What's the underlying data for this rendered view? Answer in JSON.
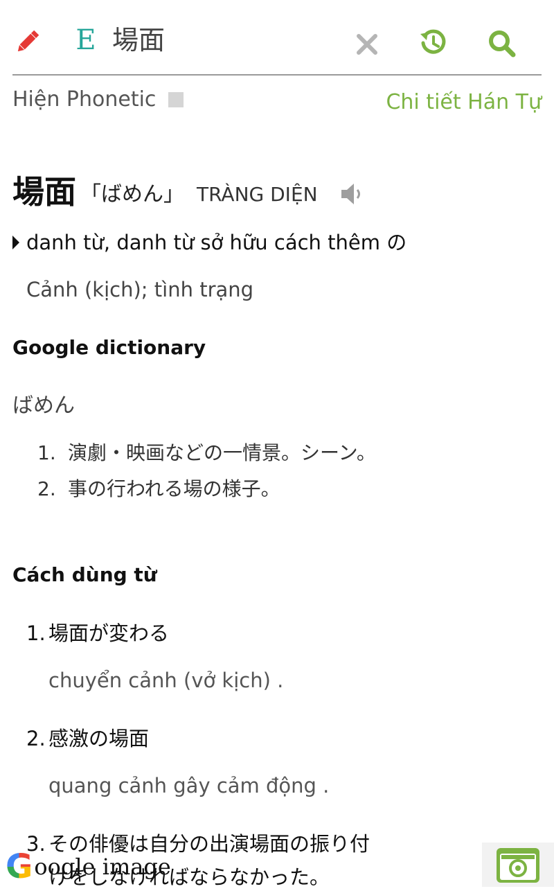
{
  "toolbar": {
    "language_badge": "E",
    "search_value": "場面"
  },
  "options": {
    "phonetic_label": "Hiện Phonetic",
    "kanji_detail_link": "Chi tiết Hán Tự"
  },
  "entry": {
    "word": "場面",
    "reading": "「ばめん」",
    "hanviet": "TRÀNG DIỆN",
    "part_of_speech": "danh từ, danh từ sở hữu cách thêm の",
    "meaning": "Cảnh (kịch); tình trạng"
  },
  "google_dictionary": {
    "title": "Google dictionary",
    "reading": "ばめん",
    "definitions": [
      {
        "num": "1.",
        "text": "演劇・映画などの一情景。シーン。"
      },
      {
        "num": "2.",
        "text": "事の行われる場の様子。"
      }
    ]
  },
  "usage": {
    "title": "Cách dùng từ",
    "examples": [
      {
        "num": "1.",
        "jp": "場面が変わる",
        "vi": "chuyển cảnh (vở kịch) ."
      },
      {
        "num": "2.",
        "jp": "感激の場面",
        "vi": "quang cảnh gây cảm động ."
      },
      {
        "num": "3.",
        "jp": "その俳優は自分の出演場面の振り付",
        "vi": ""
      }
    ],
    "overlap_text": "けをしなければならなかった。"
  },
  "bottom": {
    "google_image_g": "G",
    "google_image_label": "oogle image"
  },
  "colors": {
    "accent_green": "#7cb342",
    "pencil_red": "#e53935",
    "badge_teal": "#26a69a"
  }
}
